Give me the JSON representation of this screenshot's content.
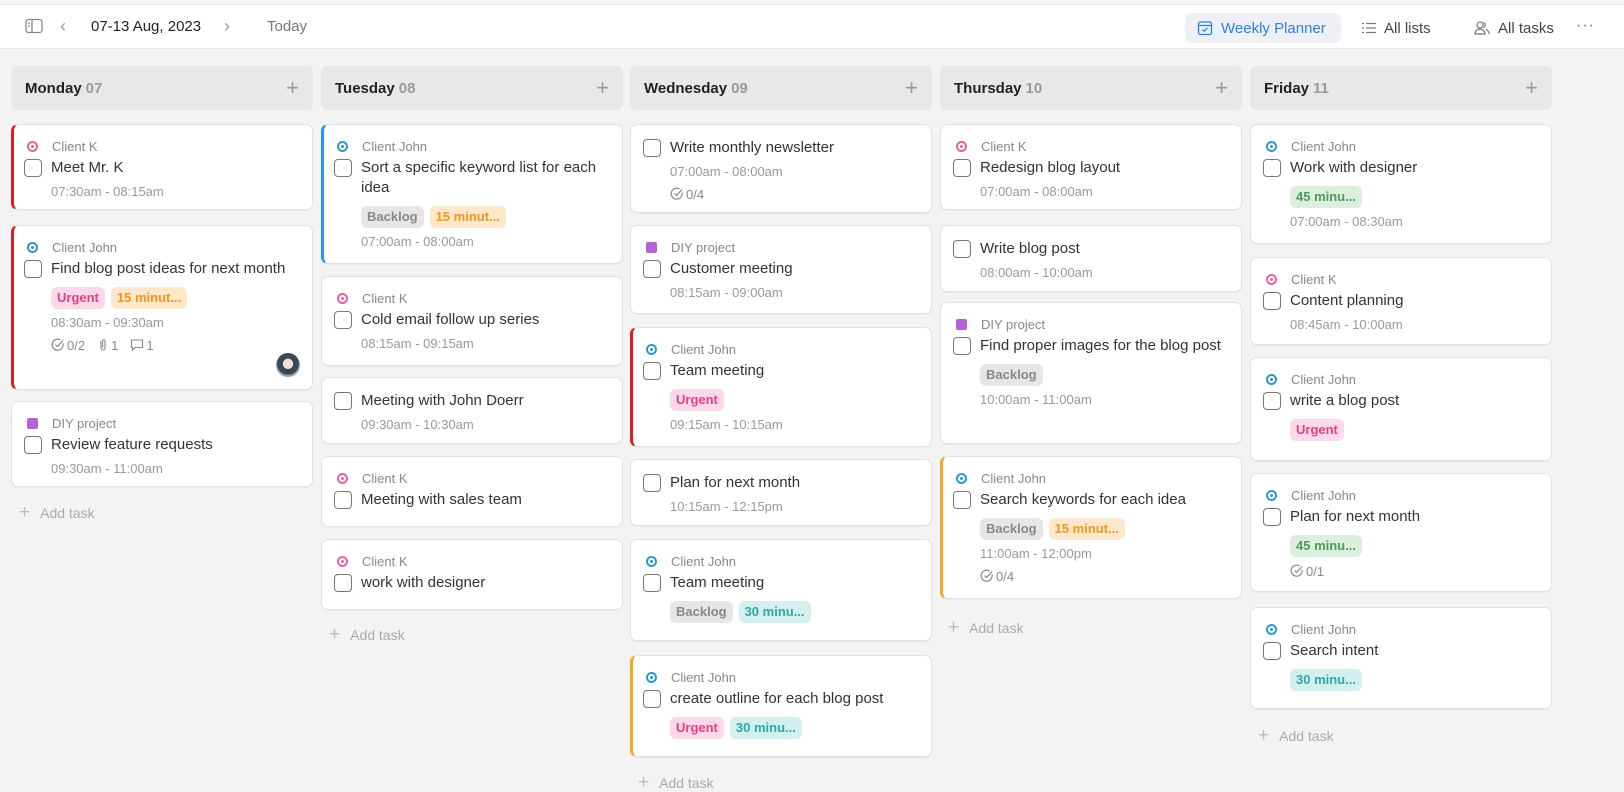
{
  "header": {
    "date_range": "07-13 Aug, 2023",
    "today_label": "Today",
    "views": [
      {
        "label": "Weekly Planner",
        "icon": "calendar-check-icon",
        "active": true
      },
      {
        "label": "All lists",
        "icon": "list-icon",
        "active": false
      },
      {
        "label": "All tasks",
        "icon": "users-icon",
        "active": false
      }
    ],
    "more_label": "···",
    "prev_label": "‹",
    "next_label": "›"
  },
  "colors": {
    "accent": "#2e7fe0",
    "client_k": "#ea5fa2",
    "client_john": "#2e97c9",
    "diy_project": "#b463d6",
    "bar_red": "#e21b1b",
    "bar_blue": "#2196f3",
    "bar_orange": "#f5a623"
  },
  "add_task_label": "Add task",
  "add_label": "+",
  "columns": [
    {
      "day": "Monday",
      "num": "07",
      "tasks": [
        {
          "project": "Client K",
          "title": "Meet Mr. K",
          "time": "07:30am - 08:15am"
        },
        {
          "project": "Client John",
          "title": "Find blog post ideas for next month",
          "tags": [
            "Urgent",
            "15 minut..."
          ],
          "time": "08:30am - 09:30am",
          "subtasks": "0/2",
          "attachments": "1",
          "comments": "1"
        },
        {
          "project": "DIY project",
          "title": "Review feature requests",
          "time": "09:30am - 11:00am"
        }
      ]
    },
    {
      "day": "Tuesday",
      "num": "08",
      "tasks": [
        {
          "project": "Client John",
          "title": "Sort a specific keyword list for each idea",
          "tags": [
            "Backlog",
            "15 minut..."
          ],
          "time": "07:00am - 08:00am"
        },
        {
          "project": "Client K",
          "title": "Cold email follow up series",
          "time": "08:15am - 09:15am"
        },
        {
          "title": "Meeting with John Doerr",
          "time": "09:30am - 10:30am"
        },
        {
          "project": "Client K",
          "title": "Meeting with sales team"
        },
        {
          "project": "Client K",
          "title": "work with designer"
        }
      ]
    },
    {
      "day": "Wednesday",
      "num": "09",
      "tasks": [
        {
          "title": "Write monthly newsletter",
          "time": "07:00am - 08:00am",
          "subtasks": "0/4"
        },
        {
          "project": "DIY project",
          "title": "Customer meeting",
          "time": "08:15am - 09:00am"
        },
        {
          "project": "Client John",
          "title": "Team meeting",
          "tags": [
            "Urgent"
          ],
          "time": "09:15am - 10:15am"
        },
        {
          "title": "Plan for next month",
          "time": "10:15am - 12:15pm"
        },
        {
          "project": "Client John",
          "title": "Team meeting",
          "tags": [
            "Backlog",
            "30 minu..."
          ]
        },
        {
          "project": "Client John",
          "title": "create outline for each blog post",
          "tags": [
            "Urgent",
            "30 minu..."
          ]
        }
      ]
    },
    {
      "day": "Thursday",
      "num": "10",
      "tasks": [
        {
          "project": "Client K",
          "title": "Redesign blog layout",
          "time": "07:00am - 08:00am"
        },
        {
          "title": "Write blog post",
          "time": "08:00am - 10:00am"
        },
        {
          "project": "DIY project",
          "title": "Find proper images for the blog post",
          "tags": [
            "Backlog"
          ],
          "time": "10:00am - 11:00am"
        },
        {
          "project": "Client John",
          "title": "Search keywords for each idea",
          "tags": [
            "Backlog",
            "15 minut..."
          ],
          "time": "11:00am - 12:00pm",
          "subtasks": "0/4"
        }
      ]
    },
    {
      "day": "Friday",
      "num": "11",
      "tasks": [
        {
          "project": "Client John",
          "title": "Work with designer",
          "tags": [
            "45 minu..."
          ],
          "time": "07:00am - 08:30am"
        },
        {
          "project": "Client K",
          "title": "Content planning",
          "time": "08:45am - 10:00am"
        },
        {
          "project": "Client John",
          "title": "write a blog post",
          "tags": [
            "Urgent"
          ]
        },
        {
          "project": "Client John",
          "title": "Plan for next month",
          "tags": [
            "45 minu..."
          ],
          "subtasks": "0/1"
        },
        {
          "project": "Client John",
          "title": "Search intent",
          "tags": [
            "30 minu..."
          ]
        }
      ]
    }
  ]
}
